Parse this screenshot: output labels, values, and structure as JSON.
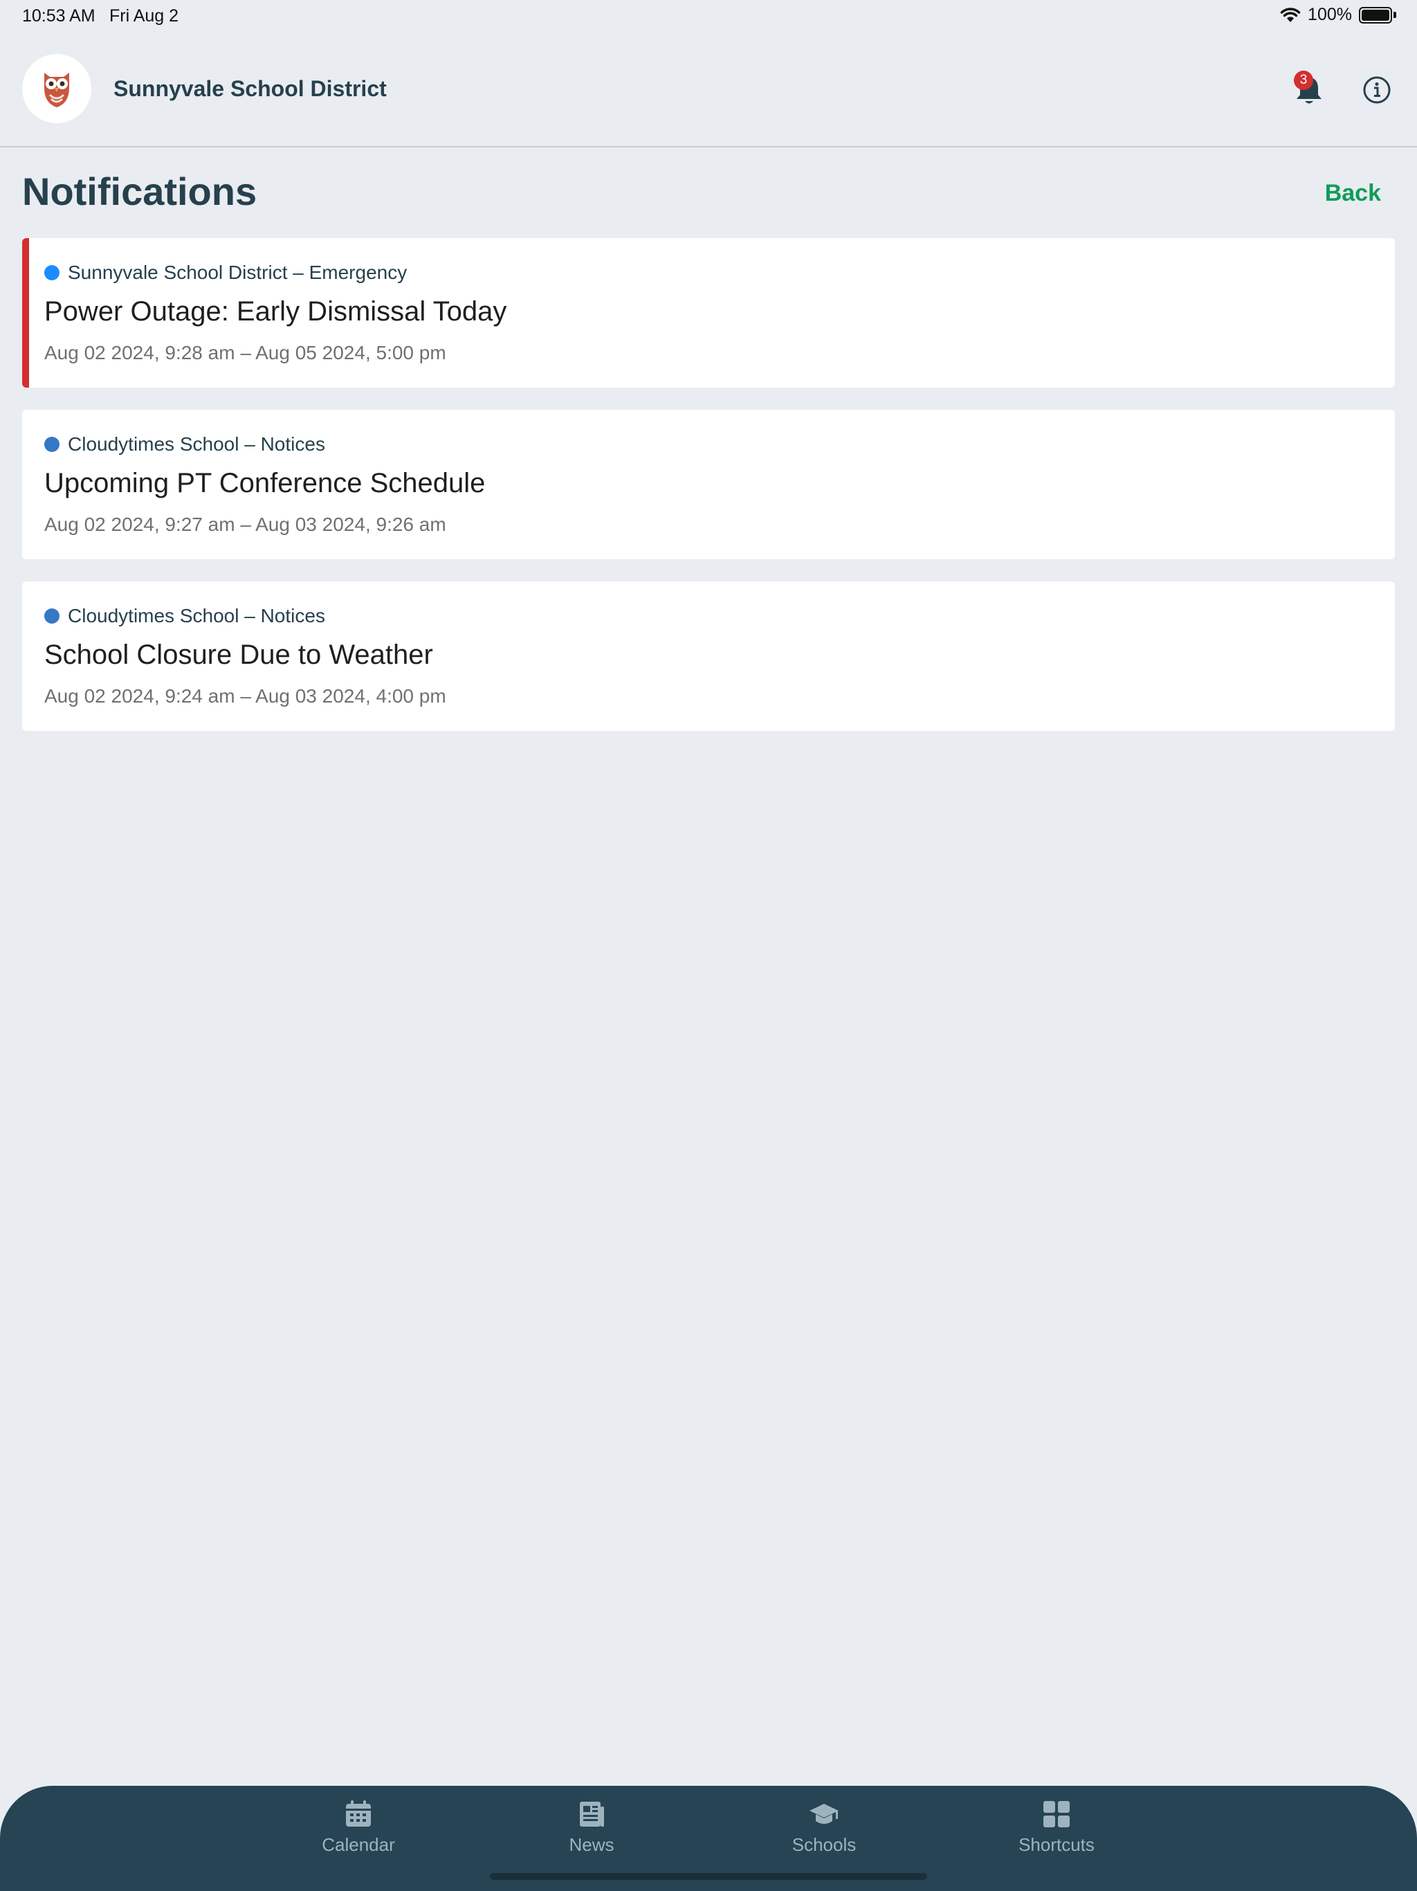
{
  "status_bar": {
    "time": "10:53 AM",
    "date": "Fri Aug 2",
    "battery_percent": "100%",
    "icons": [
      "wifi-icon",
      "battery-icon"
    ]
  },
  "header": {
    "district_name": "Sunnyvale School District",
    "logo_icon": "owl-logo-icon",
    "notification_count": "3",
    "icons": [
      "bell-icon",
      "info-icon"
    ]
  },
  "page": {
    "title": "Notifications",
    "back_label": "Back"
  },
  "notifications": [
    {
      "source": "Sunnyvale School District – Emergency",
      "title": "Power Outage: Early Dismissal Today",
      "time_range": "Aug 02 2024, 9:28 am – Aug 05 2024, 5:00 pm",
      "dot_color": "#1a8cff",
      "emergency": true
    },
    {
      "source": "Cloudytimes School – Notices",
      "title": "Upcoming PT Conference Schedule",
      "time_range": "Aug 02 2024, 9:27 am – Aug 03 2024, 9:26 am",
      "dot_color": "#3478c6",
      "emergency": false
    },
    {
      "source": "Cloudytimes School – Notices",
      "title": "School Closure Due to Weather",
      "time_range": "Aug 02 2024, 9:24 am – Aug 03 2024, 4:00 pm",
      "dot_color": "#3478c6",
      "emergency": false
    }
  ],
  "tabbar": {
    "tabs": [
      {
        "label": "Calendar",
        "icon": "calendar-icon"
      },
      {
        "label": "News",
        "icon": "newspaper-icon"
      },
      {
        "label": "Schools",
        "icon": "graduation-cap-icon"
      },
      {
        "label": "Shortcuts",
        "icon": "grid-icon"
      }
    ]
  },
  "colors": {
    "background": "#e9ecf1",
    "primary_dark": "#264453",
    "accent_green": "#0f9d58",
    "emergency_red": "#d32f2f"
  }
}
